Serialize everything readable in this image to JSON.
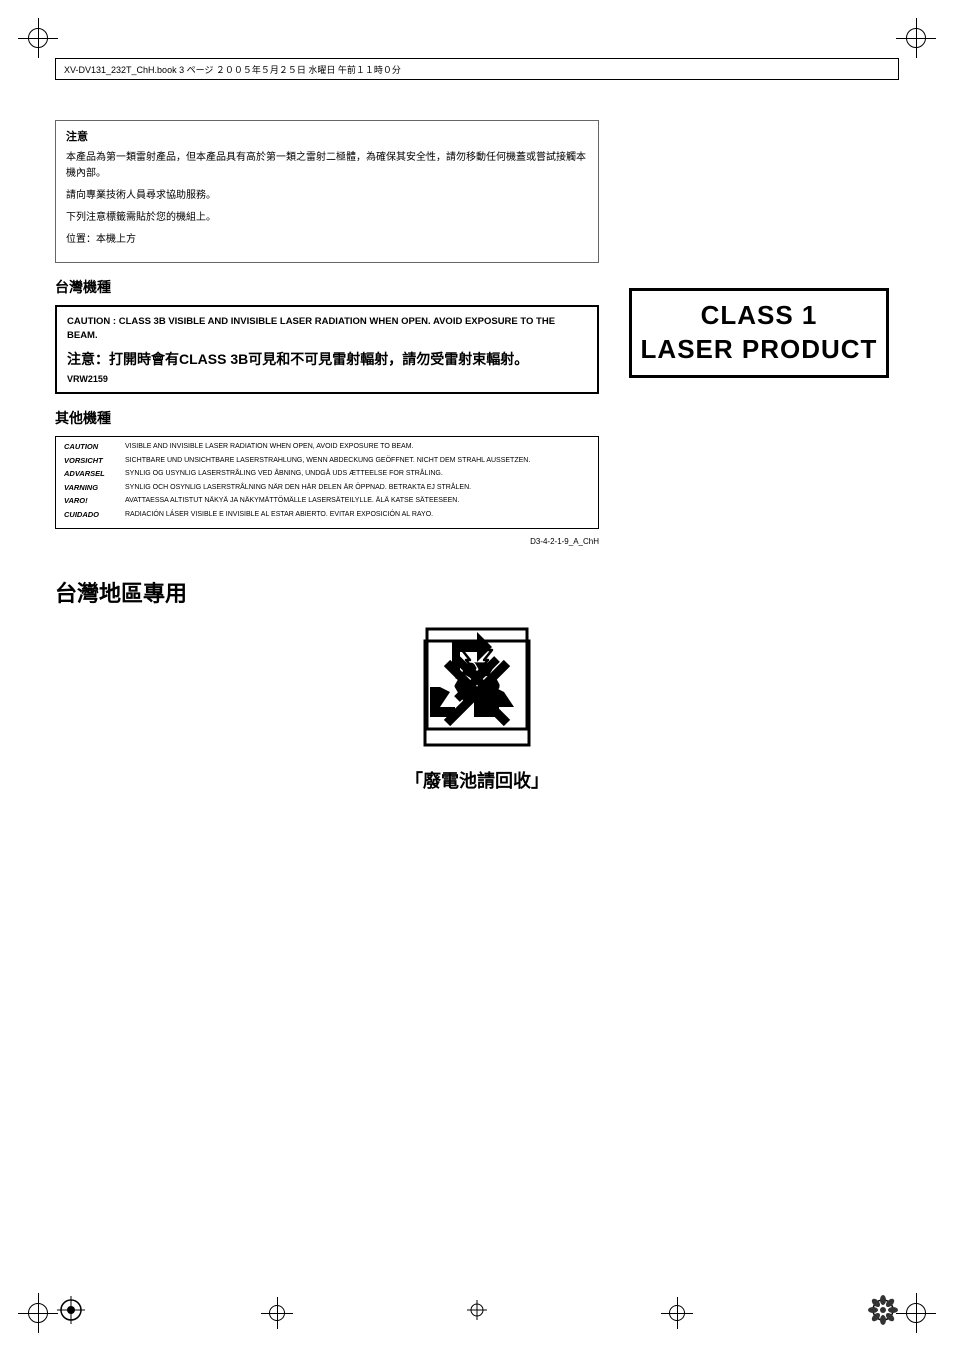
{
  "page": {
    "header_text": "XV-DV131_232T_ChH.book  3 ページ  ２００５年５月２５日  水曜日  午前１１時０分",
    "doc_ref": "D3-4-2-1-9_A_ChH"
  },
  "notes": {
    "title": "注意",
    "paragraph1": "本產品為第一類雷射產品，但本產品具有高於第一類之雷射二極體，為確保其安全性，請勿移動任何機蓋或嘗試接觸本機內部。",
    "paragraph2": "請向專業技術人員尋求協助服務。",
    "paragraph3": "下列注意標籤需貼於您的機組上。",
    "location": "位置：本機上方"
  },
  "taiwan_machine": {
    "section_title": "台灣機種",
    "caution_en": "CAUTION : CLASS 3B VISIBLE AND INVISIBLE LASER RADIATION WHEN OPEN. AVOID EXPOSURE TO THE BEAM.",
    "caution_zh": "注意：打開時會有CLASS 3B可見和不可見雷射輻射，請勿受雷射束輻射。",
    "caution_code": "VRW2159"
  },
  "class1": {
    "line1": "CLASS 1",
    "line2": "LASER PRODUCT"
  },
  "other_machines": {
    "section_title": "其他機種",
    "rows": [
      {
        "label": "CAUTION",
        "text": "VISIBLE AND INVISIBLE LASER RADIATION WHEN OPEN, AVOID EXPOSURE TO BEAM."
      },
      {
        "label": "VORSICHT",
        "text": "SICHTBARE UND UNSICHTBARE LASERSTRAHLUNG, WENN ABDECKUNG GEÖFFNET. NICHT DEM STRAHL AUSSETZEN."
      },
      {
        "label": "ADVARSEL",
        "text": "SYNLIG OG USYNLIG LASERSTRÅLING VED ÅBNING, UNDGÅ UDS ÆTTEELSE FOR STRÅLING."
      },
      {
        "label": "VARNING",
        "text": "SYNLIG OCH OSYNLIG LASERSTRÅLNING NÄR DEN HÄR DELEN ÄR ÖPPNAD. BETRAKTA EJ STRÅLEN."
      },
      {
        "label": "VARO!",
        "text": "AVATTAESSA ALTISTUT NÄKYÄ JA NÄKYMÄTTÖMÄLLE LASERSÄTEILYLLE. ÄLÄ KATSE SÄTEESEEN."
      },
      {
        "label": "CUIDADO",
        "text": "RADIACIÓN LÁSER VISIBLE E INVISIBLE AL ESTAR ABIERTO. EVITAR EXPOSICIÓN AL RAYO."
      }
    ]
  },
  "taiwan_region": {
    "title": "台灣地區專用",
    "caption": "「廢電池請回收」"
  }
}
